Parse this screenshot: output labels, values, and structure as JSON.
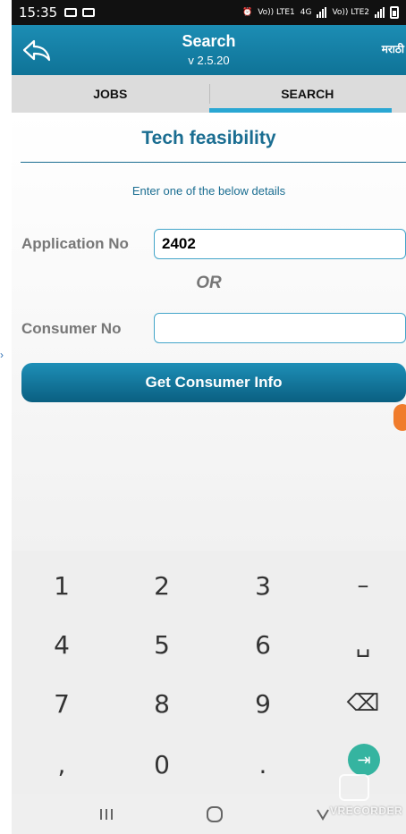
{
  "status_bar": {
    "time": "15:35",
    "network_labels": [
      "Vo)) LTE1",
      "4G",
      "Vo)) LTE2"
    ]
  },
  "header": {
    "title": "Search",
    "version": "v 2.5.20",
    "language_button": "मराठी",
    "back_icon": "back-arrow-icon"
  },
  "tabs": [
    {
      "label": "JOBS",
      "active": false
    },
    {
      "label": "SEARCH",
      "active": true
    }
  ],
  "form": {
    "heading": "Tech feasibility",
    "instruction": "Enter one of the below details",
    "application_label": "Application No",
    "application_value": "2402",
    "or_label": "OR",
    "consumer_label": "Consumer No",
    "consumer_value": "",
    "submit_label": "Get Consumer Info"
  },
  "keypad": {
    "rows": [
      [
        "1",
        "2",
        "3",
        "–"
      ],
      [
        "4",
        "5",
        "6",
        "␣"
      ],
      [
        "7",
        "8",
        "9",
        "⌫"
      ],
      [
        ",",
        "0",
        ".",
        "⇥"
      ]
    ]
  },
  "watermark": "VRECORDER",
  "colors": {
    "accent": "#1a6d91",
    "header": "#1584ab",
    "tab_indicator": "#2aa7d3",
    "enter_key": "#35b4a0",
    "badge": "#f07c2c"
  }
}
